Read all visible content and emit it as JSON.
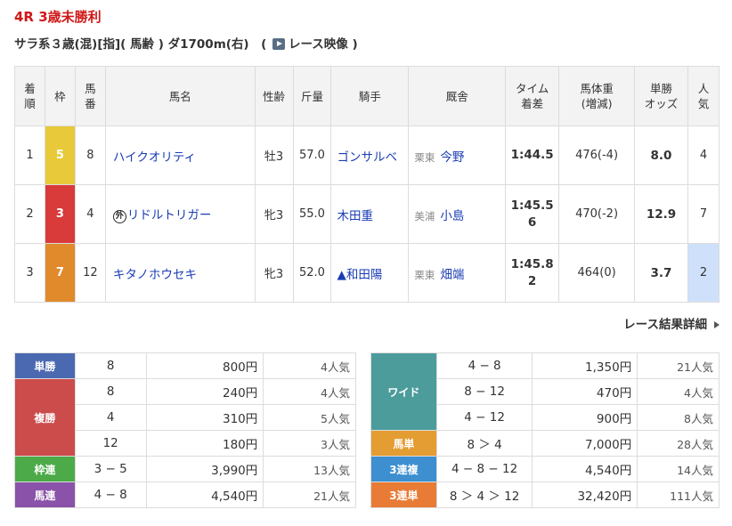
{
  "race": {
    "title": "4R 3歳未勝利",
    "conditions": "サラ系３歳(混)[指]( 馬齢 ) ダ1700m(右)　(",
    "video_label": "レース映像",
    "conditions_end": ")"
  },
  "headers": {
    "rank": "着\n順",
    "waku": "枠",
    "umaban": "馬\n番",
    "name": "馬名",
    "sexage": "性齢",
    "weight": "斤量",
    "jockey": "騎手",
    "stable": "厩舎",
    "time": "タイム\n着差",
    "body": "馬体重\n(増減)",
    "odds": "単勝\nオッズ",
    "pop": "人\n気"
  },
  "rows": [
    {
      "rank": "1",
      "waku": "5",
      "waku_color": "#e8c93a",
      "umaban": "8",
      "gai": "",
      "name": "ハイクオリティ",
      "sexage": "牡3",
      "weight": "57.0",
      "jockey": "ゴンサルベ",
      "area": "栗東",
      "trainer": "今野",
      "time1": "1:44.5",
      "time2": "",
      "body": "476(-4)",
      "odds": "8.0",
      "pop": "4",
      "pop_bg": ""
    },
    {
      "rank": "2",
      "waku": "3",
      "waku_color": "#d93a3a",
      "umaban": "4",
      "gai": "外",
      "name": "リドルトリガー",
      "sexage": "牝3",
      "weight": "55.0",
      "jockey": "木田重",
      "area": "美浦",
      "trainer": "小島",
      "time1": "1:45.5",
      "time2": "6",
      "body": "470(-2)",
      "odds": "12.9",
      "pop": "7",
      "pop_bg": ""
    },
    {
      "rank": "3",
      "waku": "7",
      "waku_color": "#e08a2c",
      "umaban": "12",
      "gai": "",
      "name": "キタノホウセキ",
      "sexage": "牝3",
      "weight": "52.0",
      "jockey": "▲和田陽",
      "area": "栗東",
      "trainer": "畑端",
      "time1": "1:45.8",
      "time2": "2",
      "body": "464(0)",
      "odds": "3.7",
      "pop": "2",
      "pop_bg": "#cfe0fb"
    }
  ],
  "detail_link": "レース結果詳細",
  "payout_left": {
    "tansho": {
      "label": "単勝",
      "color": "#4a69b0",
      "rows": [
        {
          "num": "8",
          "yen": "800円",
          "pop": "4人気"
        }
      ]
    },
    "fukusho": {
      "label": "複勝",
      "color": "#cc4b4b",
      "rows": [
        {
          "num": "8",
          "yen": "240円",
          "pop": "4人気"
        },
        {
          "num": "4",
          "yen": "310円",
          "pop": "5人気"
        },
        {
          "num": "12",
          "yen": "180円",
          "pop": "3人気"
        }
      ]
    },
    "wakuren": {
      "label": "枠連",
      "color": "#4caa49",
      "rows": [
        {
          "num": "3 − 5",
          "yen": "3,990円",
          "pop": "13人気"
        }
      ]
    },
    "umaren": {
      "label": "馬連",
      "color": "#8a52a8",
      "rows": [
        {
          "num": "4 − 8",
          "yen": "4,540円",
          "pop": "21人気"
        }
      ]
    }
  },
  "payout_right": {
    "wide": {
      "label": "ワイド",
      "color": "#4d9c9c",
      "rows": [
        {
          "num": "4 − 8",
          "yen": "1,350円",
          "pop": "21人気"
        },
        {
          "num": "8 − 12",
          "yen": "470円",
          "pop": "4人気"
        },
        {
          "num": "4 − 12",
          "yen": "900円",
          "pop": "8人気"
        }
      ]
    },
    "umatan": {
      "label": "馬単",
      "color": "#e49d32",
      "rows": [
        {
          "num": "8 ＞ 4",
          "yen": "7,000円",
          "pop": "28人気"
        }
      ]
    },
    "sanrenpuku": {
      "label": "3連複",
      "color": "#3d8fd0",
      "rows": [
        {
          "num": "4 − 8 − 12",
          "yen": "4,540円",
          "pop": "14人気"
        }
      ]
    },
    "sanrentan": {
      "label": "3連単",
      "color": "#e87b35",
      "rows": [
        {
          "num": "8 ＞ 4 ＞ 12",
          "yen": "32,420円",
          "pop": "111人気"
        }
      ]
    }
  }
}
